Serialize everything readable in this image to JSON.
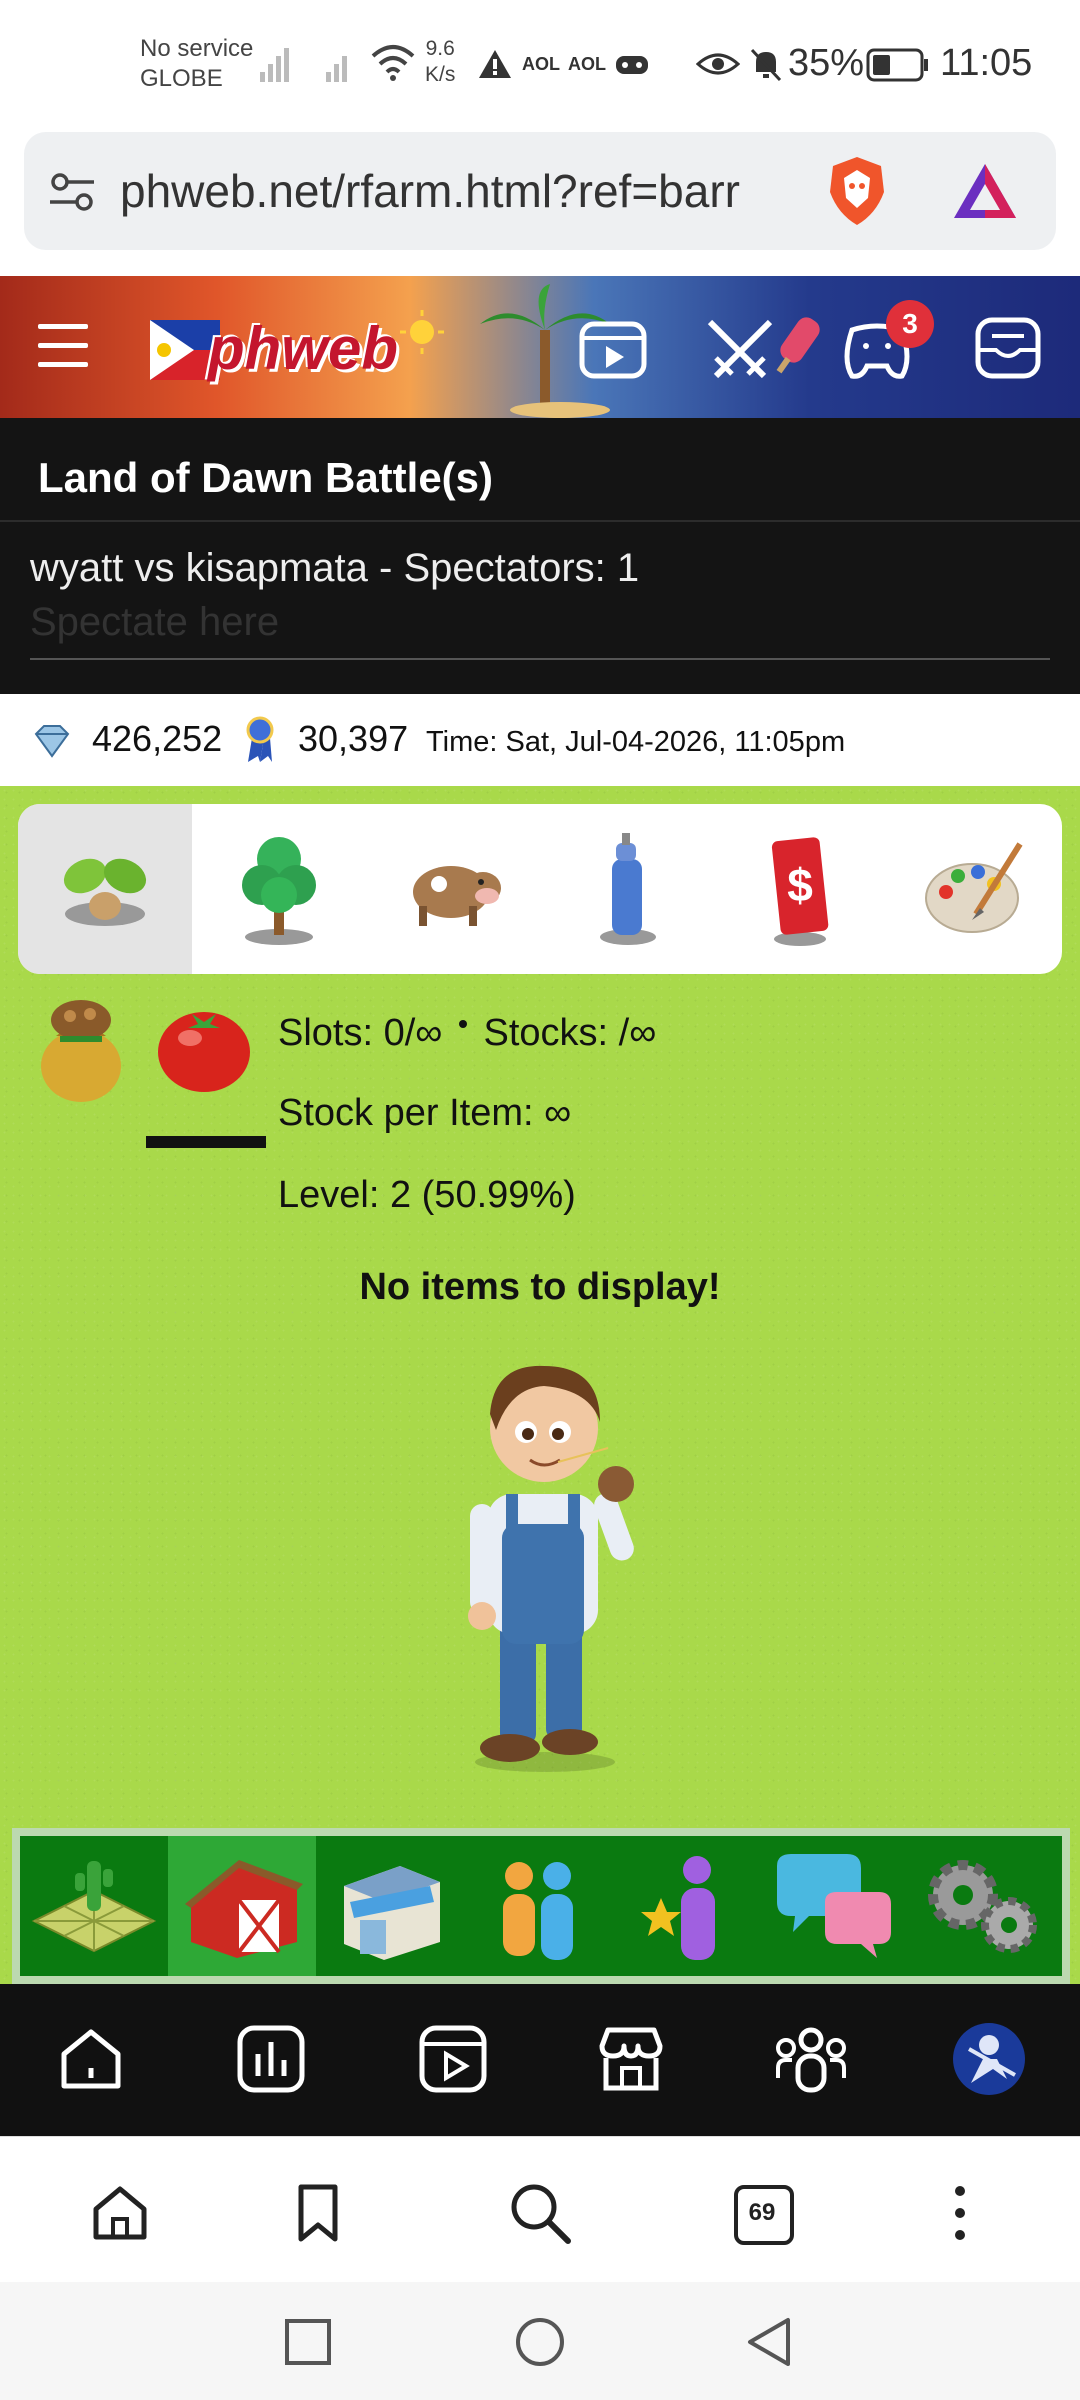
{
  "status_bar": {
    "carrier_line1": "No service",
    "carrier_line2": "GLOBE",
    "speed_line1": "9.6",
    "speed_line2": "K/s",
    "aol1": "AOL",
    "aol2": "AOL",
    "battery": "35%",
    "time": "11:05"
  },
  "browser": {
    "url": "phweb.net/rfarm.html?ref=barr",
    "tab_count": "69"
  },
  "site_header": {
    "logo_text": "phweb",
    "notification_count": "3"
  },
  "battle": {
    "title": "Land of Dawn Battle(s)",
    "match": "wyatt vs kisapmata - Spectators: 1",
    "spectate_link": "Spectate here"
  },
  "info_row": {
    "diamonds": "426,252",
    "ribbons": "30,397",
    "time": "Time: Sat, Jul-04-2026, 11:05pm"
  },
  "farm": {
    "slots": "Slots: 0/∞",
    "stocks": "Stocks: /∞",
    "stock_per_item": "Stock per Item: ∞",
    "level": "Level: 2 (50.99%)",
    "empty_message": "No items to display!"
  },
  "colors": {
    "farm_bg": "#a9d94a",
    "game_nav_bg": "#0a7a10",
    "game_nav_active": "#2ea836",
    "dark_bg": "#141414",
    "badge": "#e0303a"
  },
  "icons": {
    "farm_tabs": [
      "sprout-icon",
      "tree-icon",
      "cow-icon",
      "spray-can-icon",
      "dollar-sign-icon",
      "paint-palette-icon"
    ],
    "game_nav": [
      "farm-field-icon",
      "barn-icon",
      "shop-icon",
      "friends-icon",
      "star-user-icon",
      "chat-bubbles-icon",
      "gears-icon"
    ],
    "site_nav": [
      "home-icon",
      "stats-icon",
      "video-icon",
      "store-icon",
      "community-icon",
      "avatar"
    ],
    "browser_bar": [
      "home-icon",
      "bookmark-icon",
      "search-icon",
      "tabs-icon",
      "more-icon"
    ]
  }
}
